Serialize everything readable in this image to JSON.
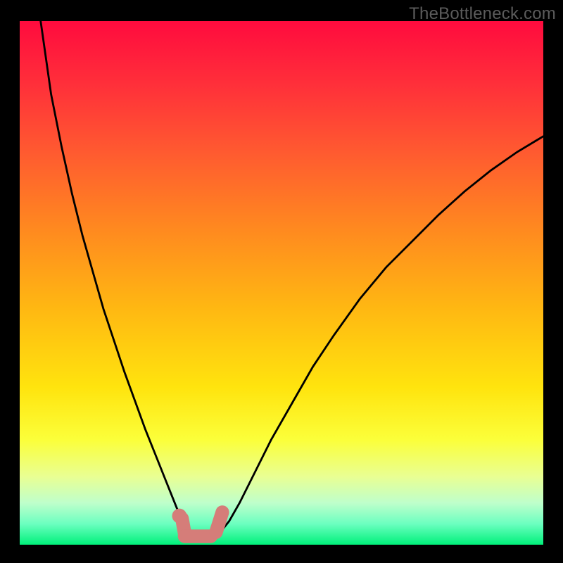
{
  "watermark": "TheBottleneck.com",
  "chart_data": {
    "type": "line",
    "title": "",
    "xlabel": "",
    "ylabel": "",
    "xlim": [
      0,
      100
    ],
    "ylim": [
      0,
      100
    ],
    "grid": false,
    "legend": false,
    "series": [
      {
        "name": "left-branch",
        "x": [
          4,
          6,
          8,
          10,
          12,
          14,
          16,
          18,
          20,
          22,
          24,
          26,
          28,
          29,
          30,
          31,
          32,
          33
        ],
        "values": [
          100,
          86,
          76,
          67,
          59,
          52,
          45,
          39,
          33,
          27.5,
          22,
          17,
          12,
          9.5,
          7,
          5,
          3.5,
          2
        ],
        "stroke": "#000000",
        "stroke_width": 3
      },
      {
        "name": "trough",
        "x": [
          33,
          34,
          35,
          36,
          37,
          38
        ],
        "values": [
          2,
          1.2,
          1,
          1,
          1.3,
          2
        ],
        "stroke": "#000000",
        "stroke_width": 3
      },
      {
        "name": "right-branch",
        "x": [
          38,
          40,
          42,
          45,
          48,
          52,
          56,
          60,
          65,
          70,
          75,
          80,
          85,
          90,
          95,
          100
        ],
        "values": [
          2,
          4.5,
          8,
          14,
          20,
          27,
          34,
          40,
          47,
          53,
          58,
          63,
          67.5,
          71.5,
          75,
          78
        ],
        "stroke": "#000000",
        "stroke_width": 3
      }
    ],
    "markers": [
      {
        "name": "trough-left-dot",
        "x": 30.5,
        "y": 5.5,
        "r": 1.4,
        "fill": "#d57d79"
      },
      {
        "name": "trough-left-bar",
        "shape": "rounded-bar",
        "x1": 31,
        "y1": 5,
        "x2": 31.5,
        "y2": 2.2,
        "width": 2.6,
        "fill": "#d57d79"
      },
      {
        "name": "trough-bottom-bar",
        "shape": "rounded-bar",
        "x1": 31.5,
        "y1": 1.6,
        "x2": 36.5,
        "y2": 1.6,
        "width": 2.6,
        "fill": "#d57d79"
      },
      {
        "name": "trough-right-bar",
        "shape": "rounded-bar",
        "x1": 37.5,
        "y1": 2.4,
        "x2": 38.7,
        "y2": 6.2,
        "width": 2.6,
        "fill": "#d57d79"
      }
    ],
    "background_gradient": {
      "direction": "vertical",
      "stops": [
        {
          "pos": 0.0,
          "color": "#ff0b3e"
        },
        {
          "pos": 0.12,
          "color": "#ff2f3a"
        },
        {
          "pos": 0.25,
          "color": "#ff5a30"
        },
        {
          "pos": 0.4,
          "color": "#ff8a1f"
        },
        {
          "pos": 0.55,
          "color": "#ffb812"
        },
        {
          "pos": 0.7,
          "color": "#ffe40e"
        },
        {
          "pos": 0.8,
          "color": "#fbff3a"
        },
        {
          "pos": 0.87,
          "color": "#e9ff93"
        },
        {
          "pos": 0.92,
          "color": "#bfffcb"
        },
        {
          "pos": 0.96,
          "color": "#6cffc0"
        },
        {
          "pos": 1.0,
          "color": "#00f07a"
        }
      ]
    }
  }
}
